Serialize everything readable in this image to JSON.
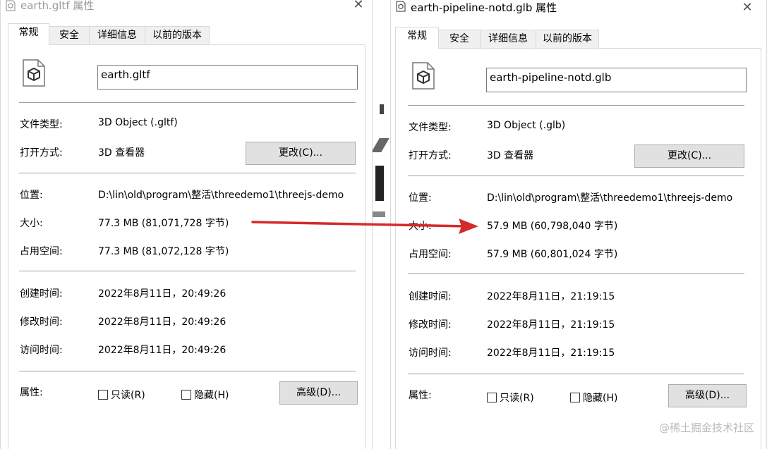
{
  "colors": {
    "arrow": "#d42a2a",
    "window_bg": "#ffffff",
    "tab_inactive_bg": "#f0f0f0",
    "button_bg": "#e1e1e1"
  },
  "left": {
    "title": "earth.gltf 属性",
    "close": "✕",
    "tabs": [
      "常规",
      "安全",
      "详细信息",
      "以前的版本"
    ],
    "filename": "earth.gltf",
    "type_label": "文件类型:",
    "type_value": "3D Object (.gltf)",
    "openwith_label": "打开方式:",
    "openwith_value": "3D 查看器",
    "change_button": "更改(C)...",
    "location_label": "位置:",
    "location_value": "D:\\lin\\old\\program\\整活\\threedemo1\\threejs-demo",
    "size_label": "大小:",
    "size_value": "77.3 MB (81,071,728 字节)",
    "disksize_label": "占用空间:",
    "disksize_value": "77.3 MB (81,072,128 字节)",
    "created_label": "创建时间:",
    "created_value": "2022年8月11日，20:49:26",
    "modified_label": "修改时间:",
    "modified_value": "2022年8月11日，20:49:26",
    "accessed_label": "访问时间:",
    "accessed_value": "2022年8月11日，20:49:26",
    "attributes_label": "属性:",
    "readonly_label": "只读(R)",
    "hidden_label": "隐藏(H)",
    "advanced_button": "高级(D)..."
  },
  "right": {
    "title": "earth-pipeline-notd.glb 属性",
    "close": "✕",
    "tabs": [
      "常规",
      "安全",
      "详细信息",
      "以前的版本"
    ],
    "filename": "earth-pipeline-notd.glb",
    "type_label": "文件类型:",
    "type_value": "3D Object (.glb)",
    "openwith_label": "打开方式:",
    "openwith_value": "3D 查看器",
    "change_button": "更改(C)...",
    "location_label": "位置:",
    "location_value": "D:\\lin\\old\\program\\整活\\threedemo1\\threejs-demo",
    "size_label": "大小:",
    "size_value": "57.9 MB (60,798,040 字节)",
    "disksize_label": "占用空间:",
    "disksize_value": "57.9 MB (60,801,024 字节)",
    "created_label": "创建时间:",
    "created_value": "2022年8月11日，21:19:15",
    "modified_label": "修改时间:",
    "modified_value": "2022年8月11日，21:19:15",
    "accessed_label": "访问时间:",
    "accessed_value": "2022年8月11日，21:19:15",
    "attributes_label": "属性:",
    "readonly_label": "只读(R)",
    "hidden_label": "隐藏(H)",
    "advanced_button": "高级(D)..."
  },
  "watermark": "@稀土掘金技术社区"
}
